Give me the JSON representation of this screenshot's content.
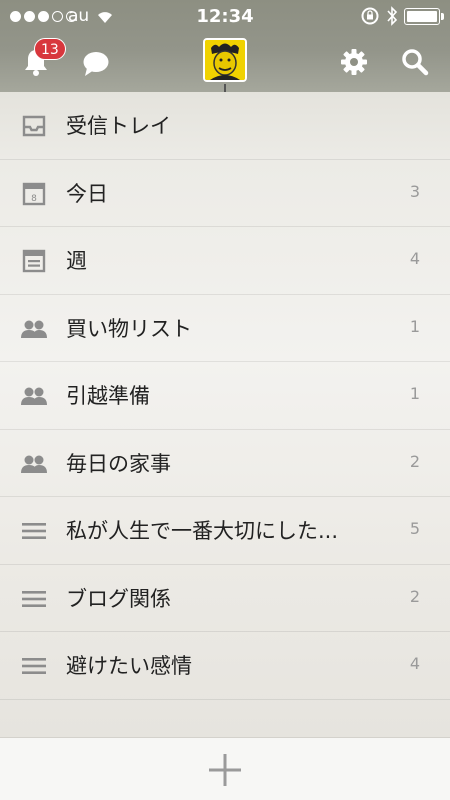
{
  "status": {
    "carrier": "au",
    "time": "12:34"
  },
  "header": {
    "notification_count": "13",
    "icons": [
      "bell-icon",
      "chat-bubble-icon",
      "avatar",
      "gear-icon",
      "search-icon"
    ]
  },
  "lists": [
    {
      "label": "受信トレイ",
      "count": "",
      "icon": "inbox-icon"
    },
    {
      "label": "今日",
      "count": "3",
      "icon": "calendar-today-icon"
    },
    {
      "label": "週",
      "count": "4",
      "icon": "calendar-week-icon"
    },
    {
      "label": "買い物リスト",
      "count": "1",
      "icon": "shared-people-icon"
    },
    {
      "label": "引越準備",
      "count": "1",
      "icon": "shared-people-icon"
    },
    {
      "label": "毎日の家事",
      "count": "2",
      "icon": "shared-people-icon"
    },
    {
      "label": "私が人生で一番大切にした...",
      "count": "5",
      "icon": "list-lines-icon"
    },
    {
      "label": "ブログ関係",
      "count": "2",
      "icon": "list-lines-icon"
    },
    {
      "label": "避けたい感情",
      "count": "4",
      "icon": "list-lines-icon"
    }
  ],
  "footer": {
    "add_icon": "plus-icon"
  },
  "colors": {
    "badge": "#d8373d",
    "icon_gray": "#8c8c8c",
    "header_bg": "#8d8f82"
  }
}
